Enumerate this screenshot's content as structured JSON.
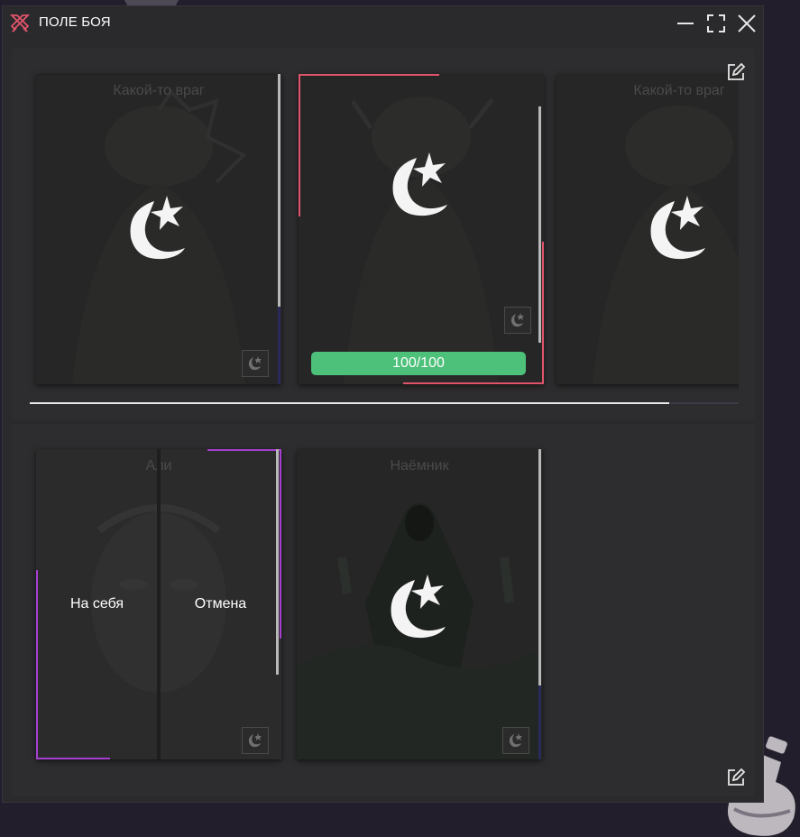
{
  "window": {
    "title": "ПОЛЕ БОЯ",
    "accent": "#e0546b"
  },
  "enemies": {
    "cards": [
      {
        "name": "Какой-то враг",
        "selected": false
      },
      {
        "name": "",
        "selected": true,
        "hp": "100/100"
      },
      {
        "name": "Какой-то враг",
        "selected": false
      }
    ],
    "scroll_fraction": 0.9
  },
  "allies": {
    "cards": [
      {
        "name": "Али",
        "action_self": "На себя",
        "action_cancel": "Отмена"
      },
      {
        "name": "Наёмник"
      }
    ]
  },
  "colors": {
    "hp_bar": "#4dc07a",
    "selected_border": "#e0546b",
    "ally_border": "#a63fd1",
    "background": "#221e2b"
  },
  "icons": [
    "crossed-swords-icon",
    "minimize-icon",
    "maximize-icon",
    "close-icon",
    "edit-icon",
    "logo-crescent-star-icon",
    "hero-badge-icon"
  ]
}
